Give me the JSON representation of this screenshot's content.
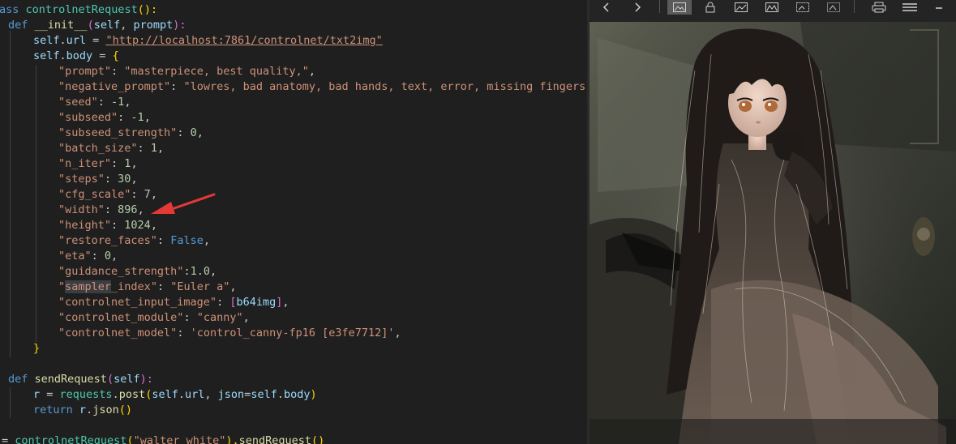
{
  "code": {
    "l1": {
      "t1": "ass",
      "t2": "controlnetRequest",
      "t3": "(",
      "t4": "):"
    },
    "l2": {
      "t1": "def",
      "t2": "__init__",
      "t3": "(",
      "t4": "self",
      "t5": ", ",
      "t6": "prompt",
      "t7": "):"
    },
    "l3": {
      "t1": "self",
      "t2": ".",
      "t3": "url",
      "t4": " = ",
      "t5": "\"http://localhost:7861/controlnet/txt2img\""
    },
    "l4": {
      "t1": "self",
      "t2": ".",
      "t3": "body",
      "t4": " = ",
      "t5": "{"
    },
    "l5": {
      "k": "\"prompt\"",
      "s": ": ",
      "v": "\"masterpiece, best quality,\"",
      "e": ","
    },
    "l6": {
      "k": "\"negative_prompt\"",
      "s": ": ",
      "v": "\"lowres, bad anatomy, bad hands, text, error, missing fingers, ext"
    },
    "l7": {
      "k": "\"seed\"",
      "s": ": ",
      "v": "-1",
      "e": ","
    },
    "l8": {
      "k": "\"subseed\"",
      "s": ": ",
      "v": "-1",
      "e": ","
    },
    "l9": {
      "k": "\"subseed_strength\"",
      "s": ": ",
      "v": "0",
      "e": ","
    },
    "l10": {
      "k": "\"batch_size\"",
      "s": ": ",
      "v": "1",
      "e": ","
    },
    "l11": {
      "k": "\"n_iter\"",
      "s": ": ",
      "v": "1",
      "e": ","
    },
    "l12": {
      "k": "\"steps\"",
      "s": ": ",
      "v": "30",
      "e": ","
    },
    "l13": {
      "k": "\"cfg_scale\"",
      "s": ": ",
      "v": "7",
      "e": ","
    },
    "l14": {
      "k": "\"width\"",
      "s": ": ",
      "v": "896",
      "e": ","
    },
    "l15": {
      "k": "\"height\"",
      "s": ": ",
      "v": "1024",
      "e": ","
    },
    "l16": {
      "k": "\"restore_faces\"",
      "s": ": ",
      "v": "False",
      "e": ","
    },
    "l17": {
      "k": "\"eta\"",
      "s": ": ",
      "v": "0",
      "e": ","
    },
    "l18": {
      "k": "\"guidance_strength\"",
      "s": ":",
      "v": "1.0",
      "e": ","
    },
    "l19": {
      "k1": "\"",
      "k2": "sampler",
      "k3": "_index\"",
      "s": ": ",
      "v": "\"Euler a\"",
      "e": ","
    },
    "l20": {
      "k": "\"controlnet_input_image\"",
      "s": ": ",
      "b1": "[",
      "v": "b64img",
      "b2": "]",
      "e": ","
    },
    "l21": {
      "k": "\"controlnet_module\"",
      "s": ": ",
      "v": "\"canny\"",
      "e": ","
    },
    "l22": {
      "k": "\"controlnet_model\"",
      "s": ": ",
      "v": "'control_canny-fp16 [e3fe7712]'",
      "e": ","
    },
    "l23": {
      "t1": "}"
    },
    "l25": {
      "t1": "def",
      "t2": "sendRequest",
      "t3": "(",
      "t4": "self",
      "t5": "):"
    },
    "l26": {
      "t1": "r",
      "t2": " = ",
      "t3": "requests",
      "t4": ".",
      "t5": "post",
      "t6": "(",
      "t7": "self",
      "t8": ".",
      "t9": "url",
      "t10": ", ",
      "t11": "json",
      "t12": "=",
      "t13": "self",
      "t14": ".",
      "t15": "body",
      "t16": ")"
    },
    "l27": {
      "t1": "return",
      "t2": " ",
      "t3": "r",
      "t4": ".",
      "t5": "json",
      "t6": "()"
    },
    "l29": {
      "t1": "= ",
      "t2": "controlnetRequest",
      "t3": "(",
      "t4": "\"walter white\"",
      "t5": ").",
      "t6": "sendRequest",
      "t7": "()"
    }
  },
  "colors": {
    "editor_bg": "#1f1f1f",
    "keyword": "#569cd6",
    "function": "#dcdcaa",
    "class": "#4ec9b0",
    "variable": "#9cdcfe",
    "string": "#ce9178",
    "number": "#b5cea8",
    "annotation_arrow": "#e53935"
  },
  "viewer": {
    "toolbar_icons": [
      "back-icon",
      "forward-icon",
      "fit-image-icon",
      "lock-icon",
      "image-mode-1-icon",
      "image-mode-2-icon",
      "image-mode-3-icon",
      "image-mode-4-icon",
      "print-icon",
      "menu-icon",
      "minimize-icon"
    ],
    "image_subject": "anime-girl-illustration"
  }
}
